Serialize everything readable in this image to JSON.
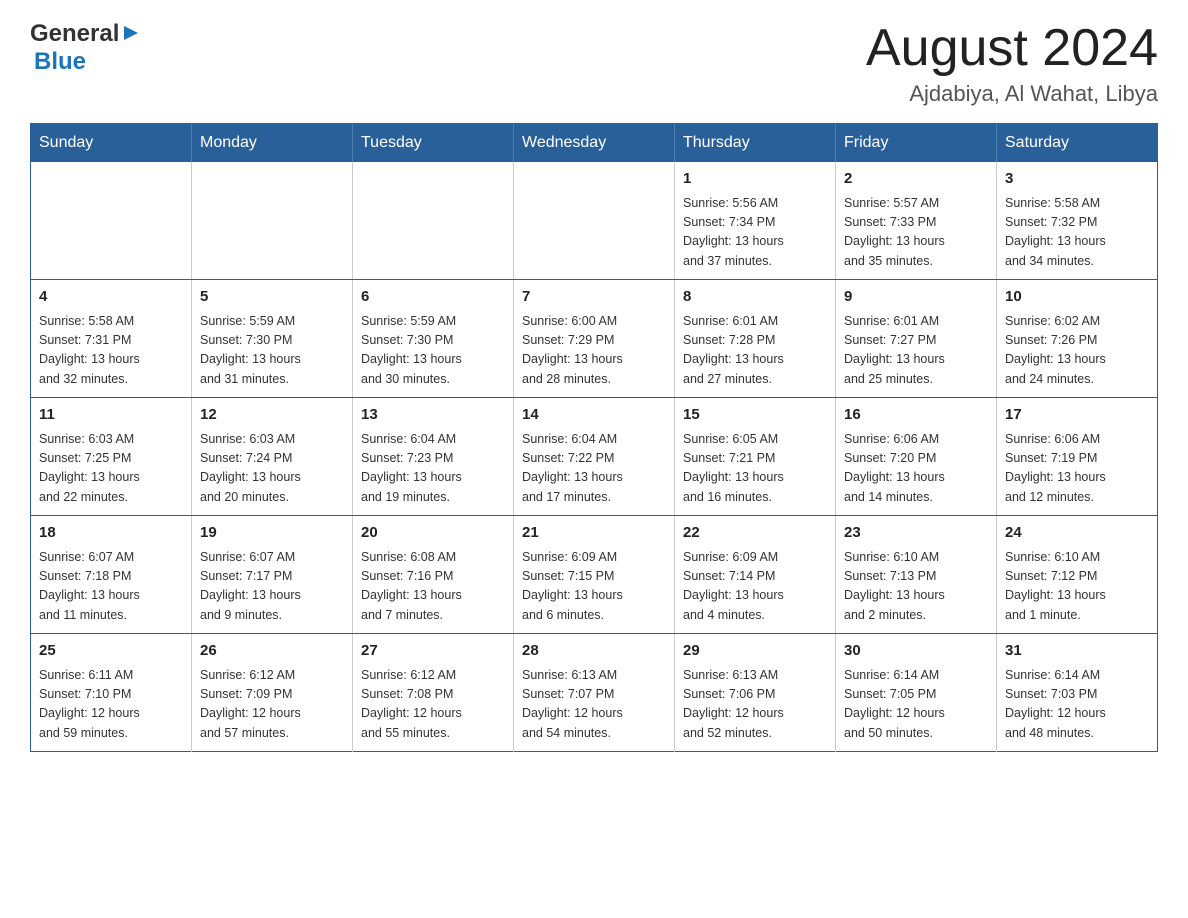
{
  "header": {
    "logo_general": "General",
    "logo_blue": "Blue",
    "month_title": "August 2024",
    "location": "Ajdabiya, Al Wahat, Libya"
  },
  "weekdays": [
    "Sunday",
    "Monday",
    "Tuesday",
    "Wednesday",
    "Thursday",
    "Friday",
    "Saturday"
  ],
  "weeks": [
    [
      {
        "day": "",
        "info": ""
      },
      {
        "day": "",
        "info": ""
      },
      {
        "day": "",
        "info": ""
      },
      {
        "day": "",
        "info": ""
      },
      {
        "day": "1",
        "info": "Sunrise: 5:56 AM\nSunset: 7:34 PM\nDaylight: 13 hours\nand 37 minutes."
      },
      {
        "day": "2",
        "info": "Sunrise: 5:57 AM\nSunset: 7:33 PM\nDaylight: 13 hours\nand 35 minutes."
      },
      {
        "day": "3",
        "info": "Sunrise: 5:58 AM\nSunset: 7:32 PM\nDaylight: 13 hours\nand 34 minutes."
      }
    ],
    [
      {
        "day": "4",
        "info": "Sunrise: 5:58 AM\nSunset: 7:31 PM\nDaylight: 13 hours\nand 32 minutes."
      },
      {
        "day": "5",
        "info": "Sunrise: 5:59 AM\nSunset: 7:30 PM\nDaylight: 13 hours\nand 31 minutes."
      },
      {
        "day": "6",
        "info": "Sunrise: 5:59 AM\nSunset: 7:30 PM\nDaylight: 13 hours\nand 30 minutes."
      },
      {
        "day": "7",
        "info": "Sunrise: 6:00 AM\nSunset: 7:29 PM\nDaylight: 13 hours\nand 28 minutes."
      },
      {
        "day": "8",
        "info": "Sunrise: 6:01 AM\nSunset: 7:28 PM\nDaylight: 13 hours\nand 27 minutes."
      },
      {
        "day": "9",
        "info": "Sunrise: 6:01 AM\nSunset: 7:27 PM\nDaylight: 13 hours\nand 25 minutes."
      },
      {
        "day": "10",
        "info": "Sunrise: 6:02 AM\nSunset: 7:26 PM\nDaylight: 13 hours\nand 24 minutes."
      }
    ],
    [
      {
        "day": "11",
        "info": "Sunrise: 6:03 AM\nSunset: 7:25 PM\nDaylight: 13 hours\nand 22 minutes."
      },
      {
        "day": "12",
        "info": "Sunrise: 6:03 AM\nSunset: 7:24 PM\nDaylight: 13 hours\nand 20 minutes."
      },
      {
        "day": "13",
        "info": "Sunrise: 6:04 AM\nSunset: 7:23 PM\nDaylight: 13 hours\nand 19 minutes."
      },
      {
        "day": "14",
        "info": "Sunrise: 6:04 AM\nSunset: 7:22 PM\nDaylight: 13 hours\nand 17 minutes."
      },
      {
        "day": "15",
        "info": "Sunrise: 6:05 AM\nSunset: 7:21 PM\nDaylight: 13 hours\nand 16 minutes."
      },
      {
        "day": "16",
        "info": "Sunrise: 6:06 AM\nSunset: 7:20 PM\nDaylight: 13 hours\nand 14 minutes."
      },
      {
        "day": "17",
        "info": "Sunrise: 6:06 AM\nSunset: 7:19 PM\nDaylight: 13 hours\nand 12 minutes."
      }
    ],
    [
      {
        "day": "18",
        "info": "Sunrise: 6:07 AM\nSunset: 7:18 PM\nDaylight: 13 hours\nand 11 minutes."
      },
      {
        "day": "19",
        "info": "Sunrise: 6:07 AM\nSunset: 7:17 PM\nDaylight: 13 hours\nand 9 minutes."
      },
      {
        "day": "20",
        "info": "Sunrise: 6:08 AM\nSunset: 7:16 PM\nDaylight: 13 hours\nand 7 minutes."
      },
      {
        "day": "21",
        "info": "Sunrise: 6:09 AM\nSunset: 7:15 PM\nDaylight: 13 hours\nand 6 minutes."
      },
      {
        "day": "22",
        "info": "Sunrise: 6:09 AM\nSunset: 7:14 PM\nDaylight: 13 hours\nand 4 minutes."
      },
      {
        "day": "23",
        "info": "Sunrise: 6:10 AM\nSunset: 7:13 PM\nDaylight: 13 hours\nand 2 minutes."
      },
      {
        "day": "24",
        "info": "Sunrise: 6:10 AM\nSunset: 7:12 PM\nDaylight: 13 hours\nand 1 minute."
      }
    ],
    [
      {
        "day": "25",
        "info": "Sunrise: 6:11 AM\nSunset: 7:10 PM\nDaylight: 12 hours\nand 59 minutes."
      },
      {
        "day": "26",
        "info": "Sunrise: 6:12 AM\nSunset: 7:09 PM\nDaylight: 12 hours\nand 57 minutes."
      },
      {
        "day": "27",
        "info": "Sunrise: 6:12 AM\nSunset: 7:08 PM\nDaylight: 12 hours\nand 55 minutes."
      },
      {
        "day": "28",
        "info": "Sunrise: 6:13 AM\nSunset: 7:07 PM\nDaylight: 12 hours\nand 54 minutes."
      },
      {
        "day": "29",
        "info": "Sunrise: 6:13 AM\nSunset: 7:06 PM\nDaylight: 12 hours\nand 52 minutes."
      },
      {
        "day": "30",
        "info": "Sunrise: 6:14 AM\nSunset: 7:05 PM\nDaylight: 12 hours\nand 50 minutes."
      },
      {
        "day": "31",
        "info": "Sunrise: 6:14 AM\nSunset: 7:03 PM\nDaylight: 12 hours\nand 48 minutes."
      }
    ]
  ]
}
